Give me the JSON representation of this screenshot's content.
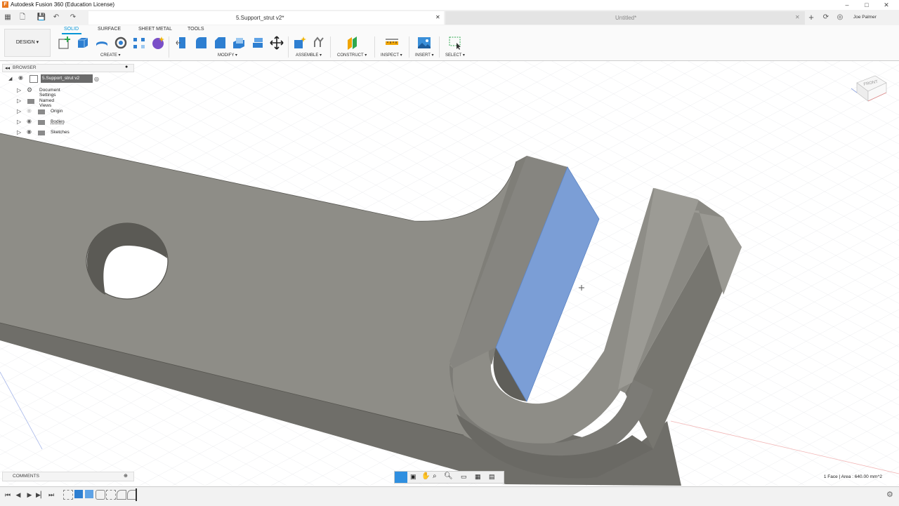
{
  "app": {
    "title": "Autodesk Fusion 360 (Education License)",
    "logo": "F"
  },
  "window_controls": {
    "minimize": "–",
    "maximize": "□",
    "close": "✕"
  },
  "tabs": {
    "active": {
      "label": "5.Support_strut v2*",
      "close": "✕"
    },
    "inactive": {
      "label": "Untitled*",
      "close": "✕"
    },
    "new_tab": "+"
  },
  "user": {
    "name": "Joe Palmer"
  },
  "toolbar": {
    "workspace": "DESIGN ▾",
    "workspace_tabs": [
      "SOLID",
      "SURFACE",
      "SHEET METAL",
      "TOOLS"
    ],
    "groups": {
      "create": "CREATE ▾",
      "modify": "MODIFY ▾",
      "assemble": "ASSEMBLE ▾",
      "construct": "CONSTRUCT ▾",
      "inspect": "INSPECT ▾",
      "insert": "INSERT ▾",
      "select": "SELECT ▾"
    },
    "accent": "#0696d7"
  },
  "browser": {
    "header": "BROWSER",
    "root": "5.Support_strut v2",
    "items": [
      "Document Settings",
      "Named Views",
      "Origin",
      "Bodies",
      "Sketches"
    ]
  },
  "comments": {
    "label": "COMMENTS"
  },
  "viewcube": {
    "face": "FRONT"
  },
  "status": {
    "selection": "1 Face | Area : 640.00 mm^2"
  },
  "colors": {
    "body": "#8c8b85",
    "selected_face": "#7b9ed6",
    "grid": "#e4e6ea"
  }
}
